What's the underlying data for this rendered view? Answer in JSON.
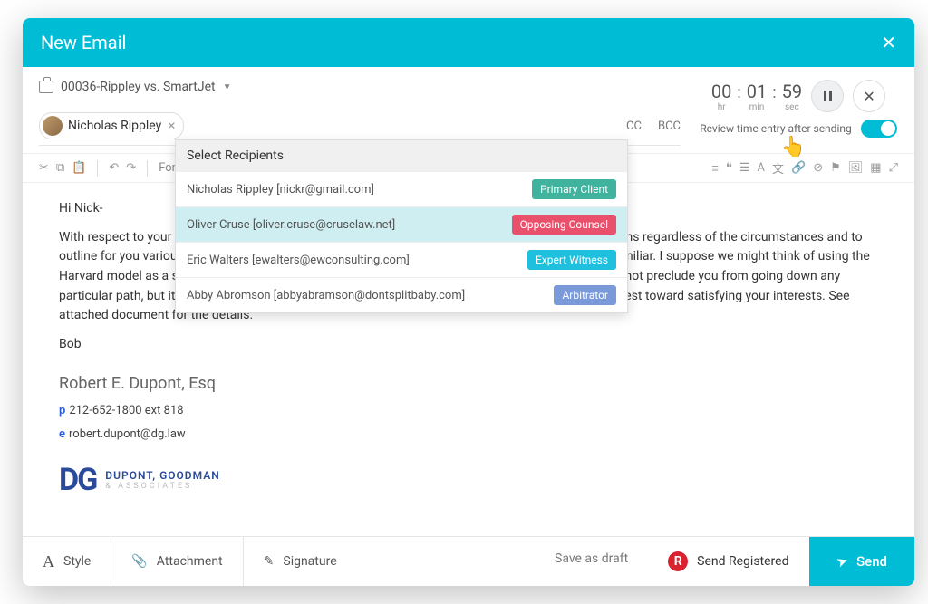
{
  "header": {
    "title": "New Email"
  },
  "case": {
    "label": "00036-Rippley vs. SmartJet"
  },
  "recipient_chip": {
    "name": "Nicholas Rippley"
  },
  "cc_label": "CC",
  "bcc_label": "BCC",
  "dropdown": {
    "title": "Select Recipients",
    "rows": [
      {
        "text": "Nicholas Rippley [nickr@gmail.com]",
        "tag": "Primary Client",
        "cls": "primary"
      },
      {
        "text": "Oliver Cruse [oliver.cruse@cruselaw.net]",
        "tag": "Opposing Counsel",
        "cls": "opposing"
      },
      {
        "text": "Eric Walters [ewalters@ewconsulting.com]",
        "tag": "Expert Witness",
        "cls": "expert"
      },
      {
        "text": "Abby Abromson [abbyabramson@dontsplitbaby.com]",
        "tag": "Arbitrator",
        "cls": "arbitrator"
      }
    ]
  },
  "timer": {
    "hr": "00",
    "min": "01",
    "sec": "59",
    "hr_l": "hr",
    "min_l": "min",
    "sec_l": "sec"
  },
  "review_label": "Review time entry after sending",
  "toolbar": {
    "font_label": "Font"
  },
  "body": {
    "greeting": "Hi Nick-",
    "para": "With respect to your dispute, I am writing to advise you on the need to make the necessary preparations regardless of the circumstances and to outline for you various options available. We talked through a lot of this, so it should be somewhat familiar. I suppose we might think of using the Harvard model as a starting point. It's important to remember that undertaking this preparation does not preclude you from going down any particular path, but it will assist you to make informed choices about which option is likely to go furthest toward satisfying your interests.  See attached document for the details.",
    "signoff": "Bob"
  },
  "signature": {
    "name": "Robert E. Dupont, Esq",
    "phone": "212-652-1800 ext 818",
    "email": "robert.dupont@dg.law",
    "firm_line1": "DUPONT, GOODMAN",
    "firm_line2": "& ASSOCIATES"
  },
  "footer": {
    "style": "Style",
    "attachment": "Attachment",
    "signature": "Signature",
    "save_draft": "Save as draft",
    "send_registered": "Send Registered",
    "send": "Send"
  }
}
